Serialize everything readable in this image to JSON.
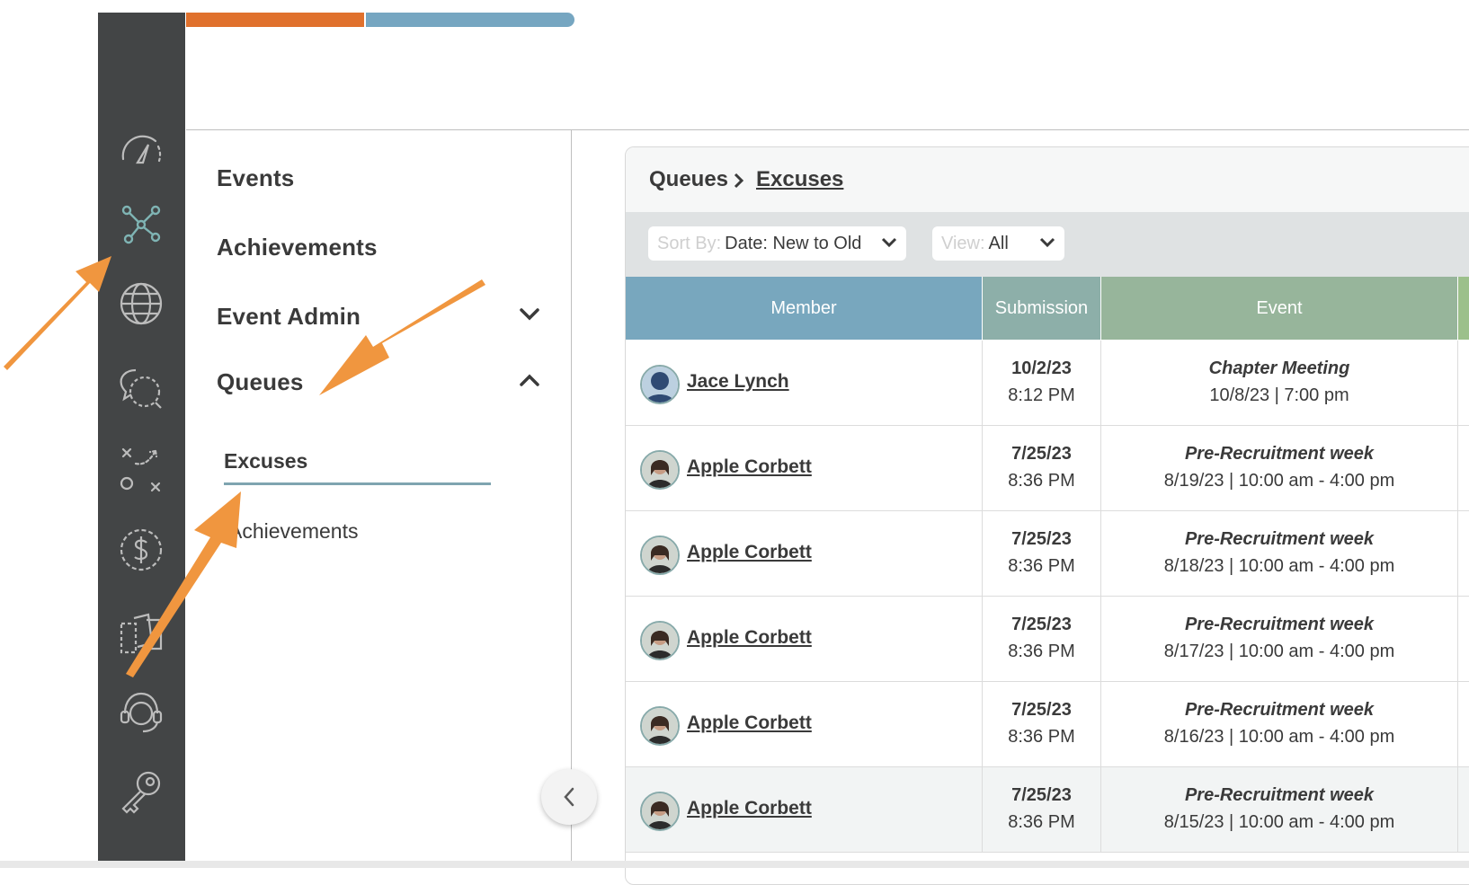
{
  "nav": {
    "events": "Events",
    "achievements": "Achievements",
    "event_admin": "Event Admin",
    "queues": "Queues",
    "queues_sub": [
      {
        "label": "Excuses",
        "active": true
      },
      {
        "label": "Achievements",
        "active": false
      }
    ]
  },
  "rail_icons": [
    "dashboard-icon",
    "network-icon",
    "globe-icon",
    "chat-icon",
    "playbook-icon",
    "dollar-icon",
    "documents-icon",
    "support-headset-icon",
    "key-icon"
  ],
  "breadcrumb": {
    "root": "Queues",
    "current": "Excuses"
  },
  "filters": {
    "sort_label": "Sort By:",
    "sort_value": "Date: New to Old",
    "view_label": "View:",
    "view_value": "All"
  },
  "table": {
    "headers": {
      "member": "Member",
      "submission": "Submission",
      "event": "Event"
    },
    "rows": [
      {
        "member": "Jace Lynch",
        "date": "10/2/23",
        "time": "8:12 PM",
        "event": "Chapter Meeting",
        "event_when": "10/8/23 | 7:00 pm"
      },
      {
        "member": "Apple Corbett",
        "date": "7/25/23",
        "time": "8:36 PM",
        "event": "Pre-Recruitment week",
        "event_when": "8/19/23 | 10:00 am - 4:00 pm"
      },
      {
        "member": "Apple Corbett",
        "date": "7/25/23",
        "time": "8:36 PM",
        "event": "Pre-Recruitment week",
        "event_when": "8/18/23 | 10:00 am - 4:00 pm"
      },
      {
        "member": "Apple Corbett",
        "date": "7/25/23",
        "time": "8:36 PM",
        "event": "Pre-Recruitment week",
        "event_when": "8/17/23 | 10:00 am - 4:00 pm"
      },
      {
        "member": "Apple Corbett",
        "date": "7/25/23",
        "time": "8:36 PM",
        "event": "Pre-Recruitment week",
        "event_when": "8/16/23 | 10:00 am - 4:00 pm"
      },
      {
        "member": "Apple Corbett",
        "date": "7/25/23",
        "time": "8:36 PM",
        "event": "Pre-Recruitment week",
        "event_when": "8/15/23 | 10:00 am - 4:00 pm"
      }
    ]
  },
  "colors": {
    "rail": "#434546",
    "accent_orange": "#e0712d",
    "accent_blue": "#76a6c1",
    "annotation_arrow": "#f0963f",
    "active_icon": "#7fb4b4"
  }
}
